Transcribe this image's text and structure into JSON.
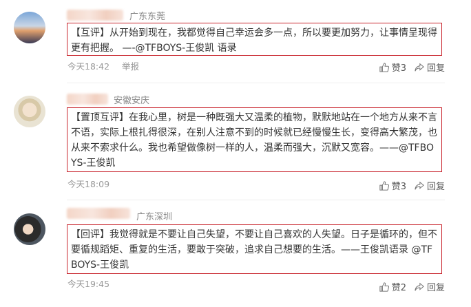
{
  "comments": [
    {
      "location": "广东东莞",
      "tag": "【互评】",
      "text": "从开始到现在，我都觉得自己幸运会多一点，所以要更加努力，让事情呈现得更有把握。 —-@TFBOYS-王俊凯 语录",
      "time": "今天18:42",
      "report": "举报",
      "likes": "赞3",
      "reply": "回复"
    },
    {
      "location": "安徽安庆",
      "tag": "【置顶互评】",
      "text": "在我心里，树是一种既强大又温柔的植物，默默地站在一个地方从来不言不语，实际上根扎得很深，在别人注意不到的时候就已经慢慢生长，变得高大繁茂，也从来不索求什么。我也希望做像树一样的人，温柔而强大，沉默又宽容。——@TFBOYS-王俊凯",
      "time": "今天18:09",
      "likes": "赞3",
      "reply": "回复"
    },
    {
      "location": "广东深圳",
      "tag": "【回评】",
      "text": "我觉得就是不要让自己失望，不要让自己喜欢的人失望。日子是循环的，但不要循规蹈矩、重复的生活，要敢于突破，追求自己想要的生活。——王俊凯语录 @TFBOYS-王俊凯",
      "time": "今天19:45",
      "likes": "赞2",
      "reply": "回复"
    }
  ],
  "icons": {
    "like": "thumbs-up-icon",
    "reply": "share-arrow-icon"
  },
  "colors": {
    "highlight_border": "#c8222a",
    "meta_text": "#999999"
  }
}
